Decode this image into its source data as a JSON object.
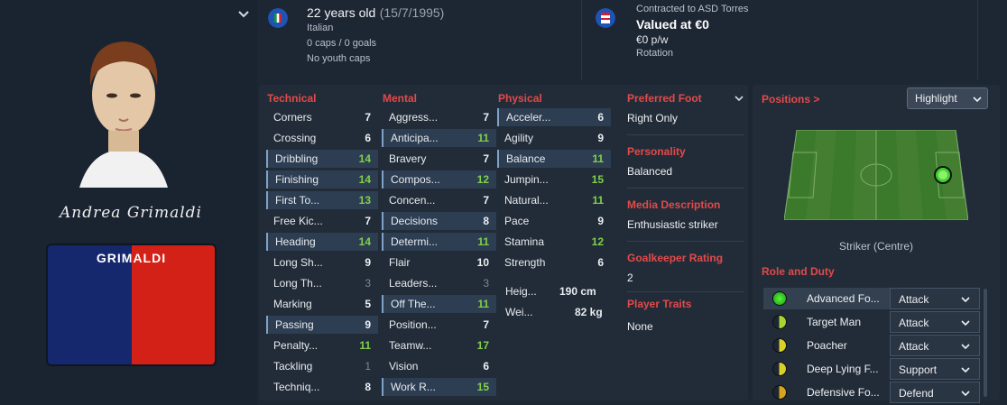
{
  "player": {
    "signature": "Andrea Grimaldi",
    "shirt_name": "GRIMALDI",
    "age_line": "22 years old",
    "dob": "(15/7/1995)",
    "nationality": "Italian",
    "caps": "0 caps / 0 goals",
    "youth_caps": "No youth caps",
    "contract": "Contracted to ASD Torres",
    "value": "Valued at €0",
    "wage": "€0 p/w",
    "squad_status": "Rotation"
  },
  "colors": {
    "accent_red": "#e24a4a",
    "green_value": "#7fd14a",
    "shirt_blue": "#15286e",
    "shirt_red": "#d42117"
  },
  "technical": {
    "title": "Technical",
    "items": [
      {
        "label": "Corners",
        "value": "7"
      },
      {
        "label": "Crossing",
        "value": "6"
      },
      {
        "label": "Dribbling",
        "value": "14"
      },
      {
        "label": "Finishing",
        "value": "14"
      },
      {
        "label": "First To...",
        "value": "13"
      },
      {
        "label": "Free Kic...",
        "value": "7"
      },
      {
        "label": "Heading",
        "value": "14"
      },
      {
        "label": "Long Sh...",
        "value": "9"
      },
      {
        "label": "Long Th...",
        "value": "3"
      },
      {
        "label": "Marking",
        "value": "5"
      },
      {
        "label": "Passing",
        "value": "9"
      },
      {
        "label": "Penalty...",
        "value": "11"
      },
      {
        "label": "Tackling",
        "value": "1"
      },
      {
        "label": "Techniq...",
        "value": "8"
      }
    ]
  },
  "mental": {
    "title": "Mental",
    "items": [
      {
        "label": "Aggress...",
        "value": "7"
      },
      {
        "label": "Anticipa...",
        "value": "11"
      },
      {
        "label": "Bravery",
        "value": "7"
      },
      {
        "label": "Compos...",
        "value": "12"
      },
      {
        "label": "Concen...",
        "value": "7"
      },
      {
        "label": "Decisions",
        "value": "8"
      },
      {
        "label": "Determi...",
        "value": "11"
      },
      {
        "label": "Flair",
        "value": "10"
      },
      {
        "label": "Leaders...",
        "value": "3"
      },
      {
        "label": "Off The...",
        "value": "11"
      },
      {
        "label": "Position...",
        "value": "7"
      },
      {
        "label": "Teamw...",
        "value": "17"
      },
      {
        "label": "Vision",
        "value": "6"
      },
      {
        "label": "Work R...",
        "value": "15"
      }
    ]
  },
  "physical": {
    "title": "Physical",
    "items": [
      {
        "label": "Acceler...",
        "value": "6"
      },
      {
        "label": "Agility",
        "value": "9"
      },
      {
        "label": "Balance",
        "value": "11"
      },
      {
        "label": "Jumpin...",
        "value": "15"
      },
      {
        "label": "Natural...",
        "value": "11"
      },
      {
        "label": "Pace",
        "value": "9"
      },
      {
        "label": "Stamina",
        "value": "12"
      },
      {
        "label": "Strength",
        "value": "6"
      }
    ],
    "height_label": "Heig...",
    "height_value": "190 cm",
    "weight_label": "Wei...",
    "weight_value": "82 kg"
  },
  "details": {
    "foot_title": "Preferred Foot",
    "foot_value": "Right Only",
    "personality_title": "Personality",
    "personality_value": "Balanced",
    "media_title": "Media Description",
    "media_value": "Enthusiastic striker",
    "gk_title": "Goalkeeper Rating",
    "gk_value": "2",
    "traits_title": "Player Traits",
    "traits_value": "None"
  },
  "positions": {
    "title": "Positions >",
    "highlight_label": "Highlight",
    "position_name": "Striker (Centre)",
    "role_title": "Role and Duty",
    "roles": [
      {
        "name": "Advanced Fo...",
        "duty": "Attack",
        "rating": "green"
      },
      {
        "name": "Target Man",
        "duty": "Attack",
        "rating": "yellow-green"
      },
      {
        "name": "Poacher",
        "duty": "Attack",
        "rating": "yellow"
      },
      {
        "name": "Deep Lying F...",
        "duty": "Support",
        "rating": "yellow"
      },
      {
        "name": "Defensive Fo...",
        "duty": "Defend",
        "rating": "orange"
      }
    ]
  },
  "icons": [
    "chevron-down-icon",
    "italy-flag-icon",
    "club-badge-icon",
    "chevron-right-icon"
  ]
}
